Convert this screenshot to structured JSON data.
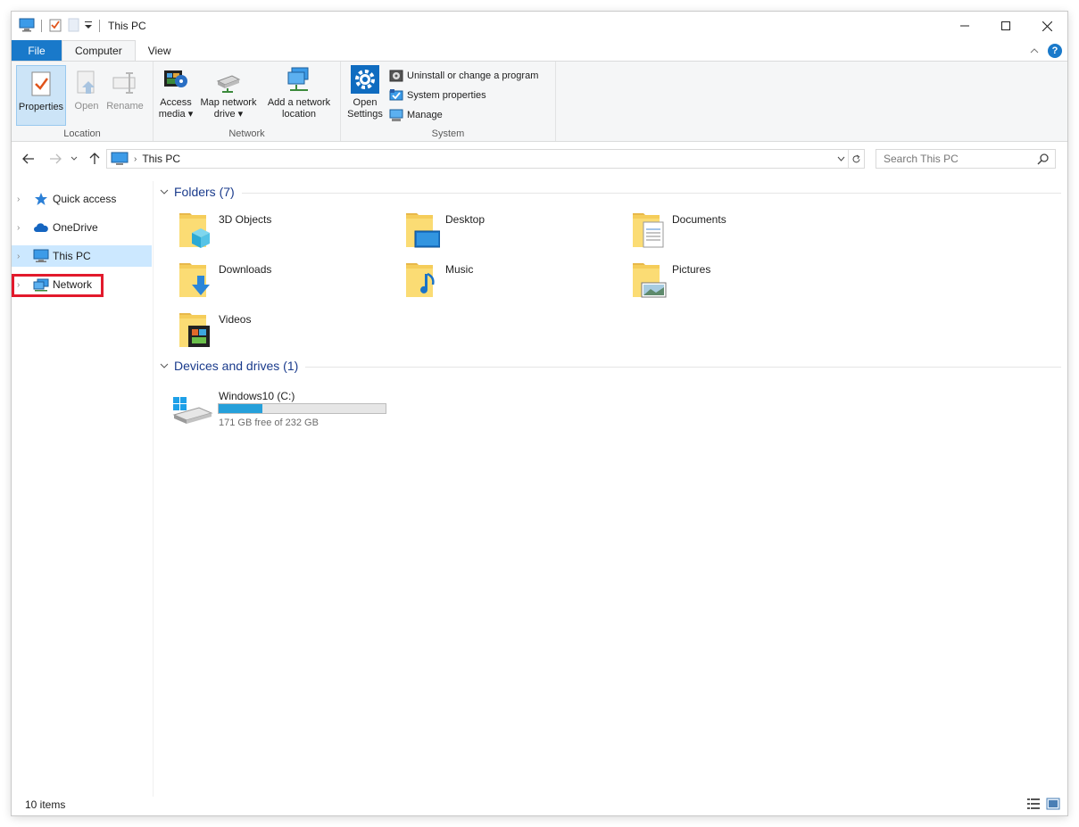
{
  "window": {
    "title": "This PC"
  },
  "tabs": {
    "file": "File",
    "computer": "Computer",
    "view": "View"
  },
  "ribbon": {
    "location": {
      "label": "Location",
      "properties": "Properties",
      "open": "Open",
      "rename": "Rename"
    },
    "network": {
      "label": "Network",
      "access_media_1": "Access",
      "access_media_2": "media",
      "map_drive_1": "Map network",
      "map_drive_2": "drive",
      "add_location_1": "Add a network",
      "add_location_2": "location"
    },
    "system": {
      "label": "System",
      "open_settings_1": "Open",
      "open_settings_2": "Settings",
      "uninstall": "Uninstall or change a program",
      "system_properties": "System properties",
      "manage": "Manage"
    }
  },
  "address": {
    "crumb": "This PC",
    "search_placeholder": "Search This PC"
  },
  "sidebar": {
    "items": [
      {
        "label": "Quick access",
        "icon": "star-icon"
      },
      {
        "label": "OneDrive",
        "icon": "cloud-icon"
      },
      {
        "label": "This PC",
        "icon": "computer-icon"
      },
      {
        "label": "Network",
        "icon": "network-icon"
      }
    ]
  },
  "folders": {
    "header": "Folders (7)",
    "items": [
      "3D Objects",
      "Desktop",
      "Documents",
      "Downloads",
      "Music",
      "Pictures",
      "Videos"
    ]
  },
  "drives": {
    "header": "Devices and drives (1)",
    "items": [
      {
        "name": "Windows10 (C:)",
        "free": "171 GB free of 232 GB",
        "used_fraction": 0.263
      }
    ]
  },
  "status": {
    "count": "10 items"
  },
  "colors": {
    "accent": "#1979ca",
    "highlight": "#e21a2c",
    "selection": "#cce8ff",
    "drive_fill": "#26a0da"
  }
}
